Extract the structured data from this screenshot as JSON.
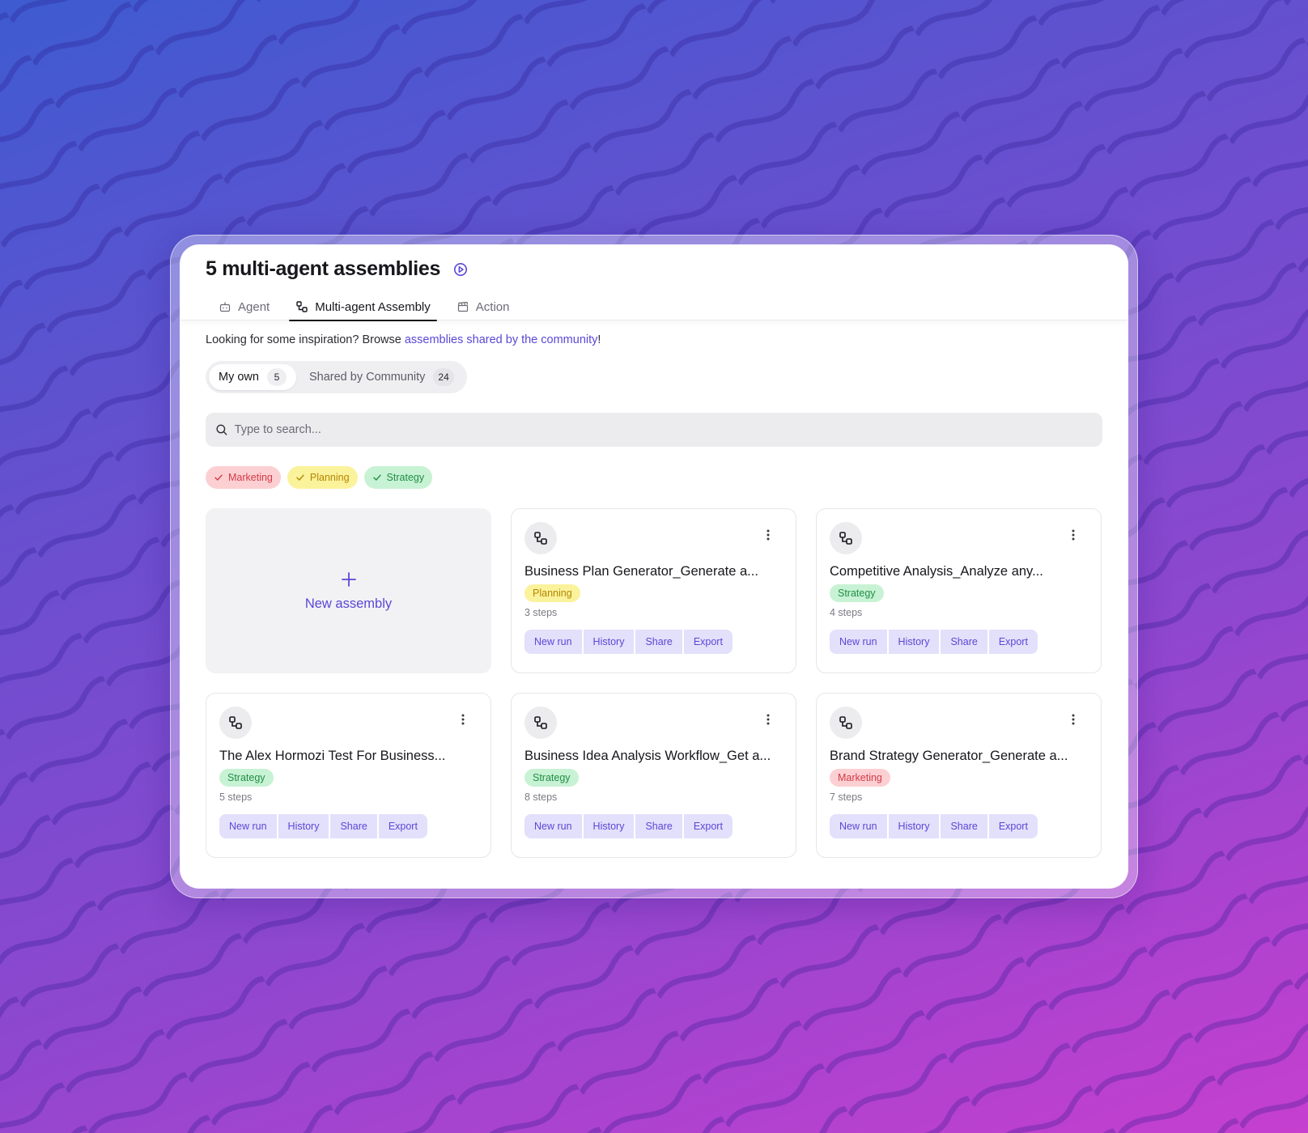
{
  "header": {
    "title": "5 multi-agent assemblies",
    "tabs": [
      {
        "label": "Agent",
        "icon": "bot-icon"
      },
      {
        "label": "Multi-agent Assembly",
        "icon": "assembly-icon",
        "active": true
      },
      {
        "label": "Action",
        "icon": "clapperboard-icon"
      }
    ]
  },
  "inspiration": {
    "prefix": "Looking for some inspiration? Browse ",
    "link": "assemblies shared by the community",
    "suffix": "!"
  },
  "segments": [
    {
      "label": "My own",
      "count": "5",
      "active": true
    },
    {
      "label": "Shared by Community",
      "count": "24",
      "active": false
    }
  ],
  "search": {
    "placeholder": "Type to search..."
  },
  "filters": [
    {
      "label": "Marketing"
    },
    {
      "label": "Planning"
    },
    {
      "label": "Strategy"
    }
  ],
  "new_card": {
    "label": "New assembly"
  },
  "actions": [
    "New run",
    "History",
    "Share",
    "Export"
  ],
  "cards": [
    {
      "title": "Business Plan Generator_Generate a...",
      "tag": "Planning",
      "steps": "3 steps"
    },
    {
      "title": "Competitive Analysis_Analyze any...",
      "tag": "Strategy",
      "steps": "4 steps"
    },
    {
      "title": "The Alex Hormozi Test For Business...",
      "tag": "Strategy",
      "steps": "5 steps"
    },
    {
      "title": "Business Idea Analysis Workflow_Get a...",
      "tag": "Strategy",
      "steps": "8 steps"
    },
    {
      "title": "Brand Strategy Generator_Generate a...",
      "tag": "Marketing",
      "steps": "7 steps"
    }
  ],
  "colors": {
    "accent": "#5b47d6",
    "marketing": "#d33a48",
    "planning": "#b58600",
    "strategy": "#1f8e46"
  }
}
